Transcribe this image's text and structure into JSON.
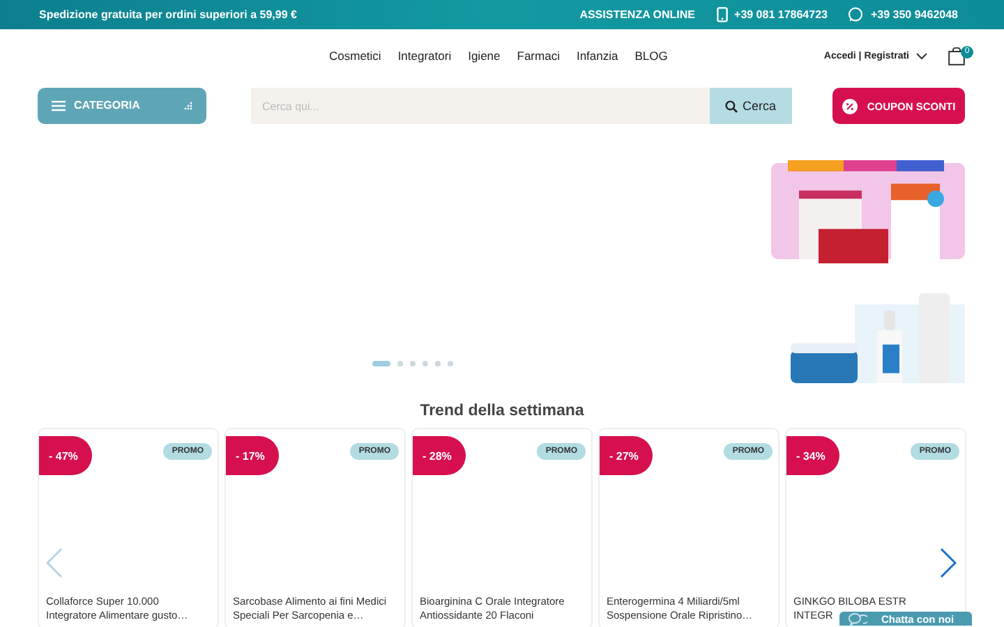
{
  "topbar": {
    "shipping": "Spedizione gratuita per ordini superiori a 59,99 €",
    "support": "ASSISTENZA ONLINE",
    "phone": "+39 081 17864723",
    "whatsapp": "+39 350 9462048"
  },
  "nav": [
    "Cosmetici",
    "Integratori",
    "Igiene",
    "Farmaci",
    "Infanzia",
    "BLOG"
  ],
  "account": {
    "label": "Accedi | Registrati",
    "cart_count": "0"
  },
  "category_button": "CATEGORIA",
  "search": {
    "placeholder": "Cerca qui...",
    "button": "Cerca"
  },
  "coupon_button": "COUPON SCONTI",
  "slider_dots": [
    {
      "selected": true
    },
    {
      "selected": false
    },
    {
      "selected": false
    },
    {
      "selected": false
    },
    {
      "selected": false
    },
    {
      "selected": false
    }
  ],
  "section_title": "Trend della settimana",
  "carousel": {
    "prev_disabled": true,
    "next_disabled": false
  },
  "products": [
    {
      "discount": "- 47%",
      "tag": "PROMO",
      "name_lines": [
        "Collaforce Super 10.000",
        "Integratore Alimentare gusto…"
      ]
    },
    {
      "discount": "- 17%",
      "tag": "PROMO",
      "name_lines": [
        "Sarcobase Alimento ai fini Medici",
        "Speciali Per Sarcopenia e…"
      ]
    },
    {
      "discount": "- 28%",
      "tag": "PROMO",
      "name_lines": [
        "Bioarginina C Orale Integratore",
        "Antiossidante 20 Flaconi"
      ]
    },
    {
      "discount": "- 27%",
      "tag": "PROMO",
      "name_lines": [
        "Enterogermina 4 Miliardi/5ml",
        "Sospensione Orale Ripristino…"
      ]
    },
    {
      "discount": "- 34%",
      "tag": "PROMO",
      "name_lines": [
        "GINKGO BILOBA ESTR",
        "INTEGR"
      ]
    }
  ],
  "chat_button": "Chatta con noi"
}
